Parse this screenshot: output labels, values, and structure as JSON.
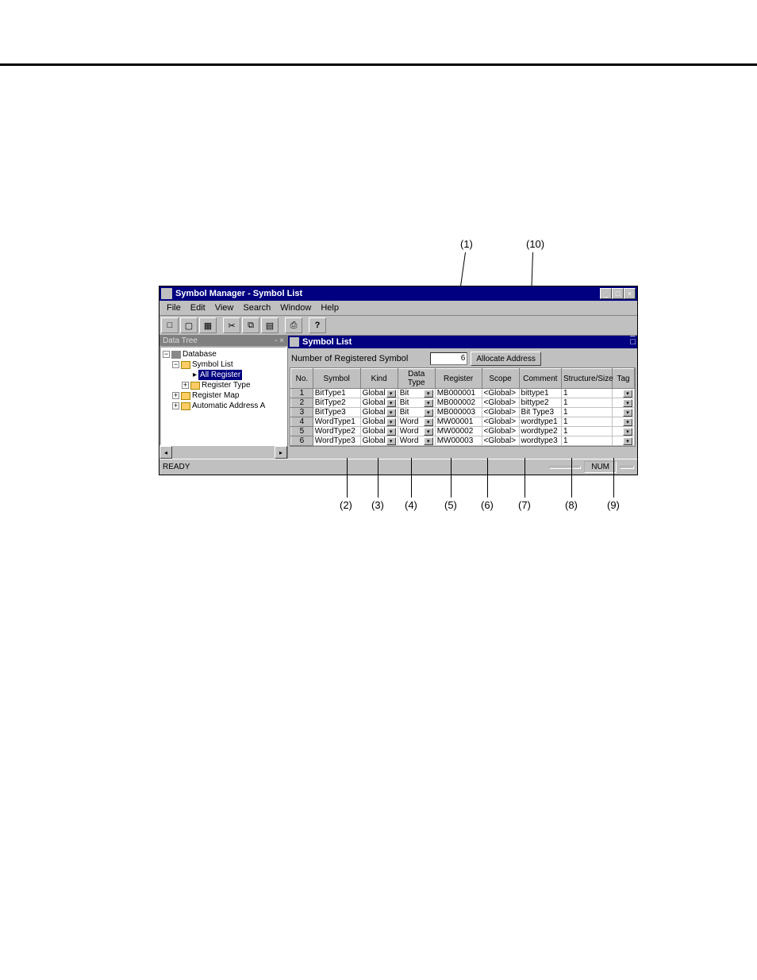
{
  "callouts": {
    "top": [
      {
        "label": "(1)"
      },
      {
        "label": "(10)"
      }
    ],
    "bottom": [
      {
        "label": "(2)"
      },
      {
        "label": "(3)"
      },
      {
        "label": "(4)"
      },
      {
        "label": "(5)"
      },
      {
        "label": "(6)"
      },
      {
        "label": "(7)"
      },
      {
        "label": "(8)"
      },
      {
        "label": "(9)"
      }
    ]
  },
  "window": {
    "title": "Symbol Manager - Symbol List",
    "menus": [
      "File",
      "Edit",
      "View",
      "Search",
      "Window",
      "Help"
    ],
    "tree_header": "Data Tree",
    "tree": {
      "root": "Database",
      "child1": "Symbol List",
      "child1a": "All Register",
      "child1b": "Register Type",
      "child2": "Register Map",
      "child3": "Automatic Address A"
    },
    "child_window_title": "Symbol List",
    "reg_label": "Number of Registered Symbol",
    "reg_count": "6",
    "alloc_btn": "Allocate Address",
    "columns": {
      "no": "No.",
      "symbol": "Symbol",
      "kind": "Kind",
      "dtype": "Data Type",
      "register": "Register",
      "scope": "Scope",
      "comment": "Comment",
      "struct": "Structure/Size",
      "tag": "Tag"
    },
    "rows": [
      {
        "no": "1",
        "symbol": "BitType1",
        "kind": "Global",
        "dtype": "Bit",
        "register": "MB000001",
        "scope": "<Global>",
        "comment": "bittype1",
        "struct": "1"
      },
      {
        "no": "2",
        "symbol": "BitType2",
        "kind": "Global",
        "dtype": "Bit",
        "register": "MB000002",
        "scope": "<Global>",
        "comment": "bittype2",
        "struct": "1"
      },
      {
        "no": "3",
        "symbol": "BitType3",
        "kind": "Global",
        "dtype": "Bit",
        "register": "MB000003",
        "scope": "<Global>",
        "comment": "Bit Type3",
        "struct": "1"
      },
      {
        "no": "4",
        "symbol": "WordType1",
        "kind": "Global",
        "dtype": "Word",
        "register": "MW00001",
        "scope": "<Global>",
        "comment": "wordtype1",
        "struct": "1"
      },
      {
        "no": "5",
        "symbol": "WordType2",
        "kind": "Global",
        "dtype": "Word",
        "register": "MW00002",
        "scope": "<Global>",
        "comment": "wordtype2",
        "struct": "1"
      },
      {
        "no": "6",
        "symbol": "WordType3",
        "kind": "Global",
        "dtype": "Word",
        "register": "MW00003",
        "scope": "<Global>",
        "comment": "wordtype3",
        "struct": "1"
      }
    ],
    "status": "READY",
    "numlock": "NUM"
  }
}
